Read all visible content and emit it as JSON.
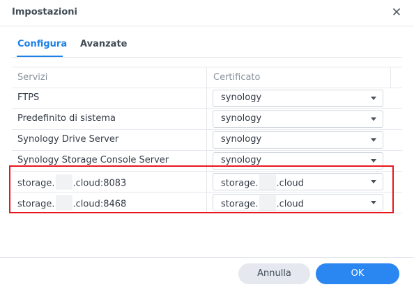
{
  "window": {
    "title": "Impostazioni"
  },
  "tabs": [
    {
      "label": "Configura",
      "active": true
    },
    {
      "label": "Avanzate",
      "active": false
    }
  ],
  "table": {
    "headers": [
      "Servizi",
      "Certificato"
    ],
    "rows": [
      {
        "service": "FTPS",
        "certificate": "synology"
      },
      {
        "service": "Predefinito di sistema",
        "certificate": "synology"
      },
      {
        "service": "Synology Drive Server",
        "certificate": "synology"
      },
      {
        "service": "Synology Storage Console Server",
        "certificate": "synology"
      },
      {
        "service_prefix": "storage.",
        "service_suffix": ".cloud:8083",
        "cert_prefix": "storage.",
        "cert_suffix": ".cloud"
      },
      {
        "service_prefix": "storage.",
        "service_suffix": ".cloud:8468",
        "cert_prefix": "storage.",
        "cert_suffix": ".cloud"
      }
    ]
  },
  "buttons": {
    "cancel": "Annulla",
    "ok": "OK"
  },
  "colors": {
    "accent": "#1a80e8",
    "highlight": "#e8161c",
    "ok_button": "#2a86f0"
  },
  "icons": {
    "close": "close-icon",
    "dropdown": "chevron-down-icon"
  }
}
